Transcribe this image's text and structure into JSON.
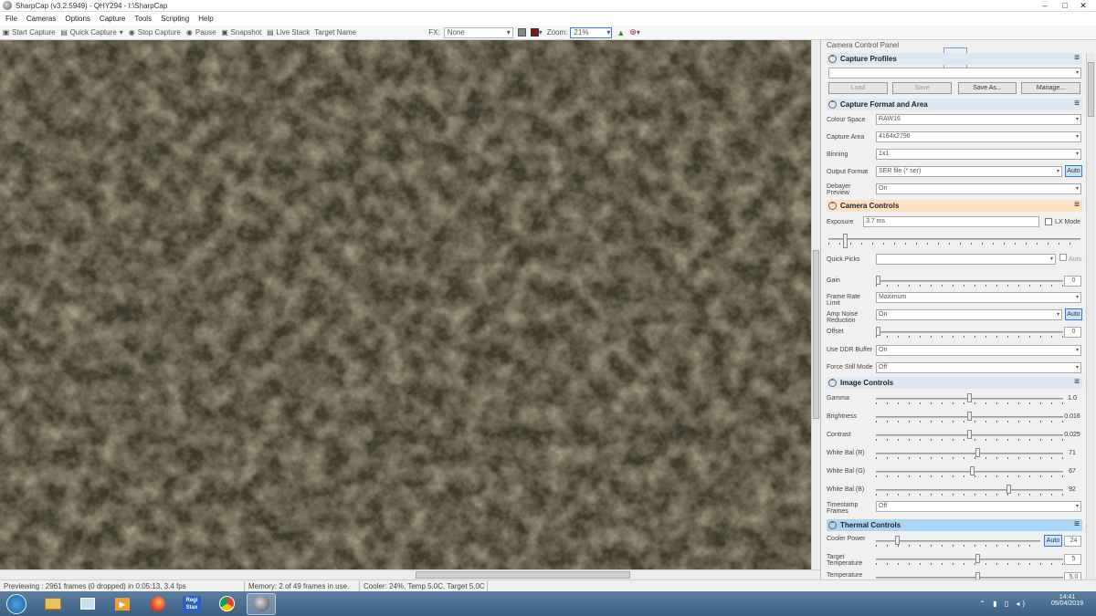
{
  "window": {
    "title": "SharpCap (v3.2.5949) - QHY294 - I:\\SharpCap",
    "controls": [
      "–",
      "□",
      "✕"
    ]
  },
  "menu": [
    "File",
    "Cameras",
    "Options",
    "Capture",
    "Tools",
    "Scripting",
    "Help"
  ],
  "toolbar": {
    "start_capture": "Start Capture",
    "quick_capture": "Quick Capture",
    "stop_capture": "Stop Capture",
    "pause": "Pause",
    "snapshot": "Snapshot",
    "live_stack": "Live Stack",
    "target_name_placeholder": "Target Name",
    "fx_label": "FX:",
    "fx_value": "None",
    "zoom_label": "Zoom:",
    "zoom_value": "21%"
  },
  "status": {
    "previewing": "Previewing : 2961 frames (0 dropped) in 0:05:13, 3.4 fps",
    "memory": "Memory: 2 of 49 frames in use.",
    "cooler": "Cooler: 24%, Temp 5.0C, Target 5.0C"
  },
  "panel": {
    "title": "Camera Control Panel",
    "sections": {
      "profiles": "Capture Profiles",
      "format": "Capture Format and Area",
      "camera": "Camera Controls",
      "image": "Image Controls",
      "thermal": "Thermal Controls"
    },
    "profile_buttons": [
      "Load",
      "Save",
      "Save As...",
      "Manage..."
    ],
    "format_rows": [
      {
        "label": "Colour Space",
        "value": "RAW16"
      },
      {
        "label": "Capture Area",
        "value": "4164x2796"
      },
      {
        "label": "Binning",
        "value": "1x1"
      },
      {
        "label": "Output Format",
        "value": "SER file (*.ser)",
        "extra": "Auto"
      },
      {
        "label": "Debayer Preview",
        "value": "On"
      }
    ],
    "exposure": {
      "label": "Exposure",
      "value": "3.7 ms",
      "lx_mode": "LX Mode",
      "level": 0.06
    },
    "quick_picks": {
      "label": "Quick Picks",
      "auto": "Auto"
    },
    "camera_rows": [
      {
        "label": "Gain",
        "kind": "slider",
        "value": "0",
        "level": 0.0
      },
      {
        "label": "Frame Rate Limit",
        "kind": "dropdown",
        "value": "Maximum"
      },
      {
        "label": "Amp Noise Reduction",
        "kind": "dropdown",
        "value": "On",
        "extra": "Auto"
      },
      {
        "label": "Offset",
        "kind": "slider",
        "value": "0",
        "level": 0.0
      },
      {
        "label": "Use DDR Buffer",
        "kind": "dropdown",
        "value": "On"
      },
      {
        "label": "Force Still Mode",
        "kind": "dropdown",
        "value": "Off"
      }
    ],
    "image_rows": [
      {
        "label": "Gamma",
        "value": "1.0",
        "level": 0.5
      },
      {
        "label": "Brightness",
        "value": "0.016",
        "level": 0.5
      },
      {
        "label": "Contrast",
        "value": "0.025",
        "level": 0.5
      },
      {
        "label": "White Bal (R)",
        "value": "71",
        "level": 0.55
      },
      {
        "label": "White Bal (G)",
        "value": "67",
        "level": 0.52
      },
      {
        "label": "White Bal (B)",
        "value": "92",
        "level": 0.72
      }
    ],
    "timestamp": {
      "label": "Timestamp Frames",
      "value": "Off"
    },
    "thermal_rows": [
      {
        "label": "Cooler Power",
        "value": "24",
        "extra": "Auto",
        "level": 0.12
      },
      {
        "label": "Target Temperature",
        "value": "5",
        "level": 0.55
      },
      {
        "label": "Temperature",
        "value": "5.0",
        "level": 0.55
      }
    ]
  },
  "taskbar": {
    "apps": [
      "start-orb",
      "file-explorer",
      "image-viewer",
      "media-player",
      "firefox",
      "regi-stax",
      "chrome",
      "sharpcap"
    ],
    "regi_label": "Regi Stax",
    "time": "14:41",
    "date": "05/04/2019"
  },
  "colors": {
    "section_blue": "#cfe4f7",
    "section_active": "#fde2c4",
    "thermal_blue": "#a9d5f5"
  }
}
